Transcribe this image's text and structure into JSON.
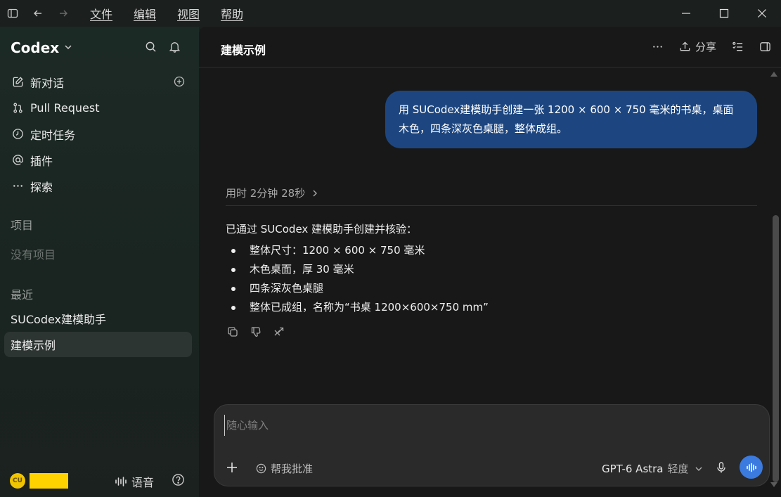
{
  "window": {
    "menu": [
      "文件",
      "编辑",
      "视图",
      "帮助"
    ]
  },
  "sidebar": {
    "app_name": "Codex",
    "nav": [
      {
        "label": "新对话",
        "icon": "edit-icon"
      },
      {
        "label": "Pull Request",
        "icon": "git-pull-request-icon"
      },
      {
        "label": "定时任务",
        "icon": "clock-icon"
      },
      {
        "label": "插件",
        "icon": "at-sign-icon"
      },
      {
        "label": "探索",
        "icon": "more-dots-icon"
      }
    ],
    "projects_label": "项目",
    "projects_empty": "没有项目",
    "recent_label": "最近",
    "recent": [
      "SUCodex建模助手",
      "建模示例"
    ],
    "footer": {
      "avatar_initials": "CU",
      "voice_label": "语音"
    }
  },
  "main": {
    "title": "建模示例",
    "share_label": "分享",
    "user_message": "用 SUCodex建模助手创建一张 1200 × 600 × 750 毫米的书桌，桌面木色，四条深灰色桌腿，整体成组。",
    "elapsed": "用时 2分钟 28秒",
    "answer": {
      "intro": "已通过 SUCodex 建模助手创建并核验：",
      "items": [
        "整体尺寸：1200 × 600 × 750 毫米",
        "木色桌面，厚 30 毫米",
        "四条深灰色桌腿",
        "整体已成组，名称为“书桌 1200×600×750 mm”"
      ]
    }
  },
  "composer": {
    "placeholder": "随心输入",
    "approve_label": "帮我批准",
    "model": "GPT-6 Astra",
    "effort": "轻度"
  },
  "colors": {
    "user_bubble": "#1d4680",
    "send_button": "#3b7be0",
    "avatar": "#f0c400"
  }
}
